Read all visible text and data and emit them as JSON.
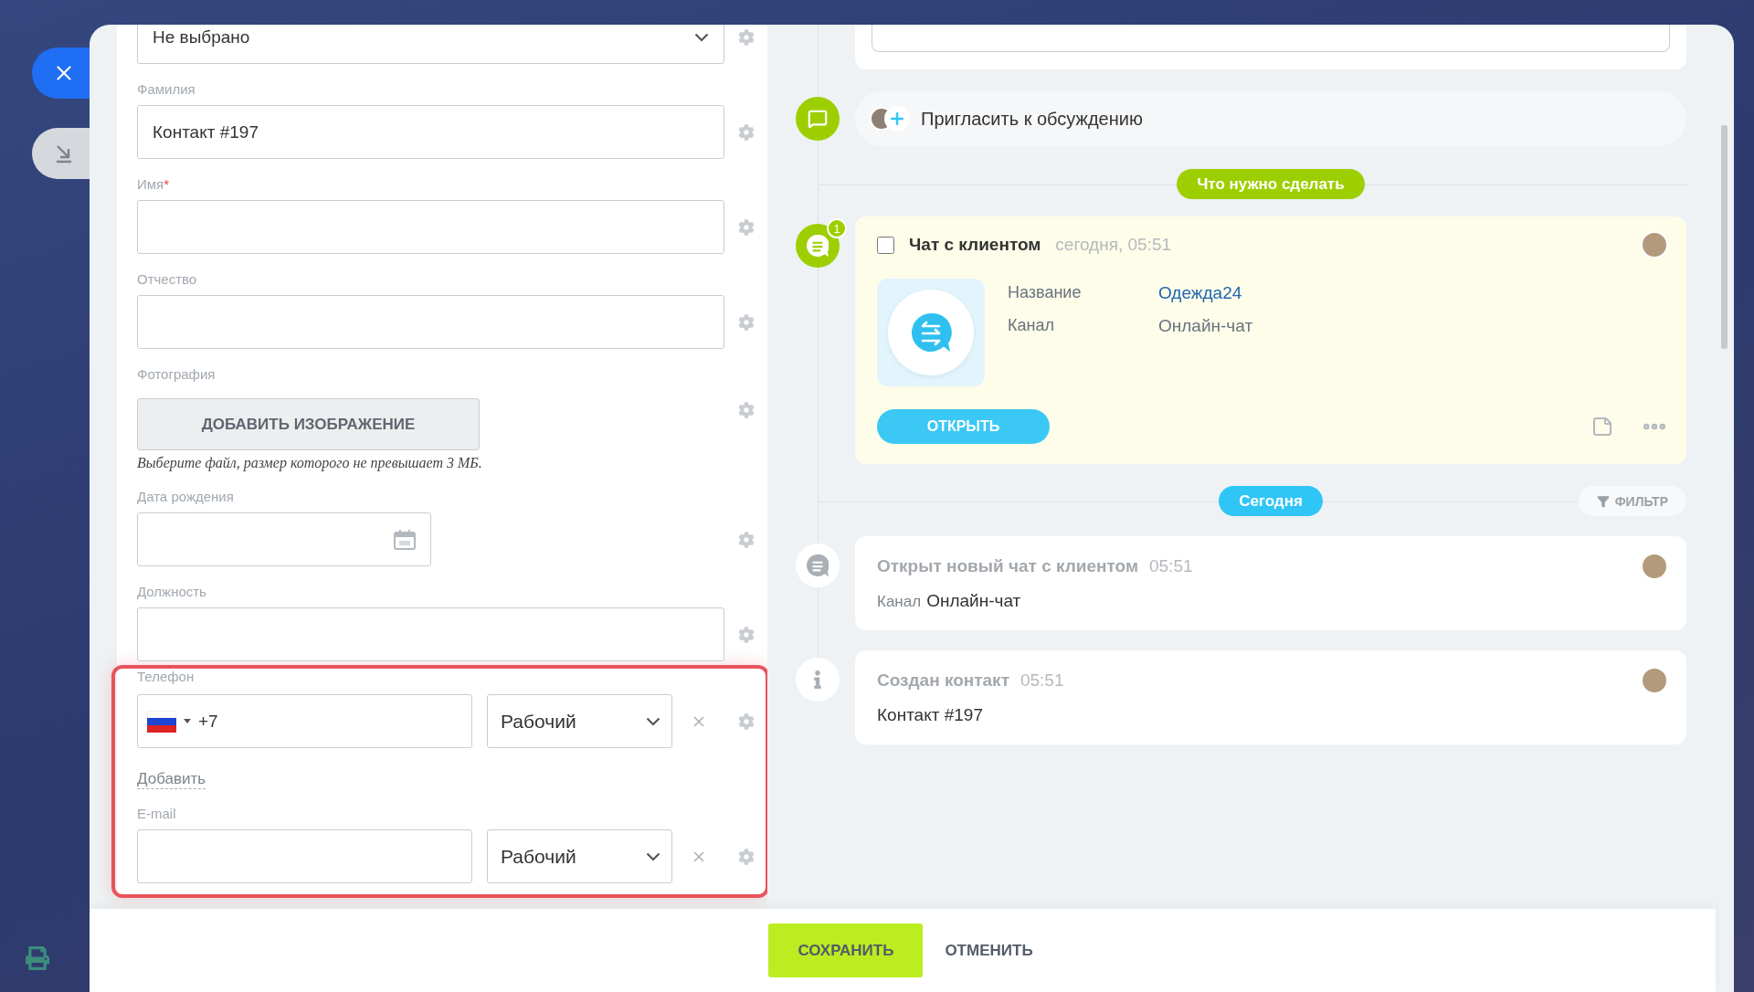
{
  "form": {
    "fields": [
      {
        "kind": "select",
        "value": "Не выбрано"
      },
      {
        "kind": "text",
        "label": "Фамилия",
        "value": "Контакт #197"
      },
      {
        "kind": "text",
        "label": "Имя",
        "required_mark": "*"
      },
      {
        "kind": "text",
        "label": "Отчество"
      },
      {
        "kind": "image",
        "label": "Фотография",
        "button": "ДОБАВИТЬ ИЗОБРАЖЕНИЕ",
        "hint": "Выберите файл, размер которого не превышает 3 МБ."
      },
      {
        "kind": "date",
        "label": "Дата рождения"
      },
      {
        "kind": "text",
        "label": "Должность"
      }
    ],
    "contact_group": {
      "highlighted": true,
      "phone": {
        "label": "Телефон",
        "code": "+7",
        "type": "Рабочий"
      },
      "add_link": "Добавить",
      "email": {
        "label": "E-mail",
        "type": "Рабочий"
      }
    }
  },
  "timeline": {
    "invite": "Пригласить к обсуждению",
    "planned_badge": "Что нужно сделать",
    "task": {
      "title": "Чат с клиентом",
      "time": "сегодня, 05:51",
      "checked": false,
      "counter": "1",
      "button": "ОТКРЫТЬ",
      "fields": [
        {
          "label": "Название",
          "value": "Одежда24",
          "kind": "link"
        },
        {
          "label": "Канал",
          "value": "Онлайн-чат",
          "kind": "text"
        }
      ]
    },
    "today_badge": "Сегодня",
    "filter": "ФИЛЬТР",
    "events": [
      {
        "kind": "chat",
        "title": "Открыт новый чат с клиентом",
        "time": "05:51",
        "detail_label": "Канал",
        "detail_value": "Онлайн-чат"
      },
      {
        "kind": "info",
        "title": "Создан контакт",
        "time": "05:51",
        "detail_value": "Контакт #197"
      }
    ]
  },
  "footer": {
    "buttons": [
      {
        "label": "СОХРАНИТЬ",
        "kind": "primary"
      },
      {
        "label": "ОТМЕНИТЬ",
        "kind": "link"
      }
    ]
  }
}
